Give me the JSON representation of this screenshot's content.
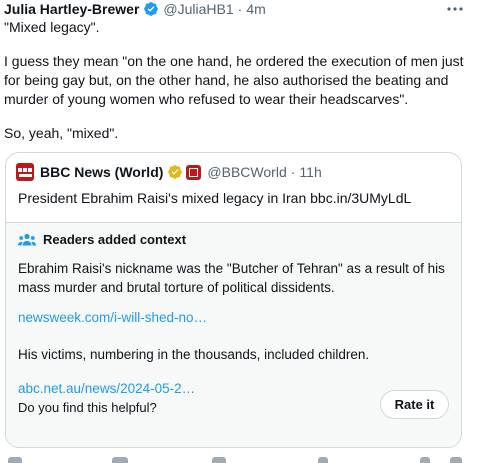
{
  "tweet": {
    "author_name": "Julia Hartley-Brewer",
    "handle": "@JuliaHB1",
    "separator": "·",
    "time": "4m",
    "lines": [
      "\"Mixed legacy\".",
      "I guess they mean \"on the one hand, he ordered the execution of men just for being gay but, on the other hand, he also authorised the beating and murder of young women who refused to wear their headscarves\".",
      "So, yeah, \"mixed\"."
    ]
  },
  "quoted": {
    "author_name": "BBC News (World)",
    "handle": "@BBCWorld",
    "separator": "·",
    "time": "11h",
    "text": "President Ebrahim Raisi's mixed legacy in Iran bbc.in/3UMyLdL"
  },
  "context": {
    "title": "Readers added context",
    "paragraph1": "Ebrahim Raisi's nickname was the \"Butcher of Tehran\" as a result of his mass murder and brutal torture of political dissidents.",
    "link1": "newsweek.com/i-will-shed-no…",
    "paragraph2": "His victims, numbering in the thousands, included children.",
    "link2": "abc.net.au/news/2024-05-2…",
    "helpful_question": "Do you find this helpful?",
    "rate_label": "Rate it"
  },
  "colors": {
    "accent_blue": "#1d9bf0",
    "bbc_red": "#bb1919",
    "verified_gold": "#e2b719",
    "muted_text": "#536471"
  },
  "icons": [
    "verified-badge-icon",
    "more-options-icon",
    "bbc-logo-icon",
    "gold-verified-icon",
    "affiliate-badge-icon",
    "readers-people-icon"
  ]
}
